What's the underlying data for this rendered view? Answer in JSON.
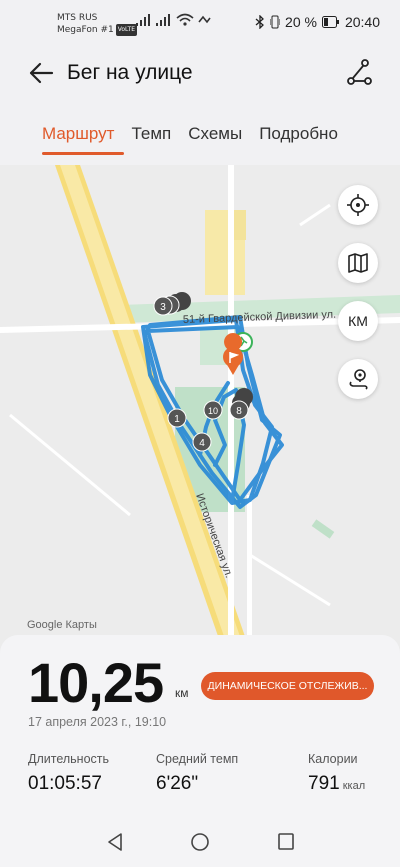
{
  "status_bar": {
    "carrier1": "MTS RUS",
    "carrier2": "MegaFon #1",
    "volte": "VoLTE",
    "battery": "20 %",
    "time": "20:40"
  },
  "header": {
    "title": "Бег на улице"
  },
  "tabs": [
    {
      "label": "Маршрут",
      "active": true
    },
    {
      "label": "Темп",
      "active": false
    },
    {
      "label": "Схемы",
      "active": false
    },
    {
      "label": "Подробно",
      "active": false
    }
  ],
  "map": {
    "street_top": "51-й Гвардейской Дивизии ул.",
    "street_diag": "Историческая ул.",
    "attribution": "Google Карты",
    "km_button": "КМ",
    "markers": [
      "1",
      "3",
      "4",
      "8",
      "10"
    ],
    "route_color": "#2a8ad6"
  },
  "summary": {
    "distance": "10,25",
    "distance_unit": "км",
    "dynamic_button": "ДИНАМИЧЕСКОЕ ОТСЛЕЖИВ...",
    "date": "17 апреля 2023 г., 19:10"
  },
  "stats": [
    {
      "label": "Длительность",
      "value": "01:05:57",
      "unit": ""
    },
    {
      "label": "Средний темп",
      "value": "6'26\"",
      "unit": ""
    },
    {
      "label": "Калории",
      "value": "791",
      "unit": "ккал"
    }
  ],
  "colors": {
    "accent": "#e05a2b"
  }
}
